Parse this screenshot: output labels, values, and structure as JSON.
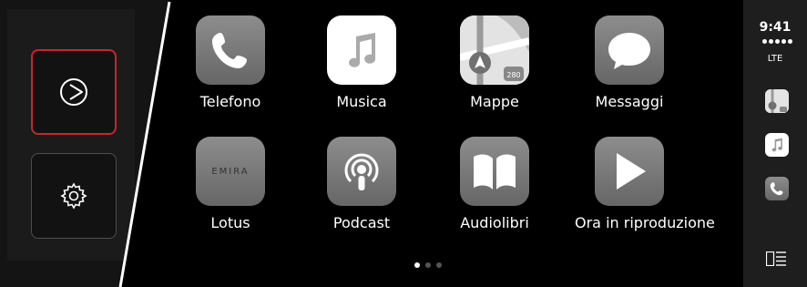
{
  "apps": [
    {
      "label": "Telefono",
      "icon": "phone-icon"
    },
    {
      "label": "Musica",
      "icon": "music-icon"
    },
    {
      "label": "Mappe",
      "icon": "maps-icon"
    },
    {
      "label": "Messaggi",
      "icon": "messages-icon"
    },
    {
      "label": "Lotus",
      "icon": "lotus-icon",
      "icon_text": "EMIRA"
    },
    {
      "label": "Podcast",
      "icon": "podcast-icon"
    },
    {
      "label": "Audiolibri",
      "icon": "audiobooks-icon"
    },
    {
      "label": "Ora in riproduzione",
      "icon": "now-playing-icon"
    }
  ],
  "sidebar": {
    "buttons": [
      {
        "name": "play",
        "icon": "play-circle-icon",
        "selected": true
      },
      {
        "name": "settings",
        "icon": "gear-icon",
        "selected": false
      }
    ]
  },
  "status": {
    "time": "9:41",
    "network": "LTE",
    "recent_apps": [
      "maps-icon",
      "music-icon",
      "phone-icon"
    ],
    "switch_icon": "layout-switch-icon"
  },
  "pagination": {
    "pages": 3,
    "current": 1
  },
  "colors": {
    "selected_border": "#c9252c",
    "background": "#000000"
  }
}
